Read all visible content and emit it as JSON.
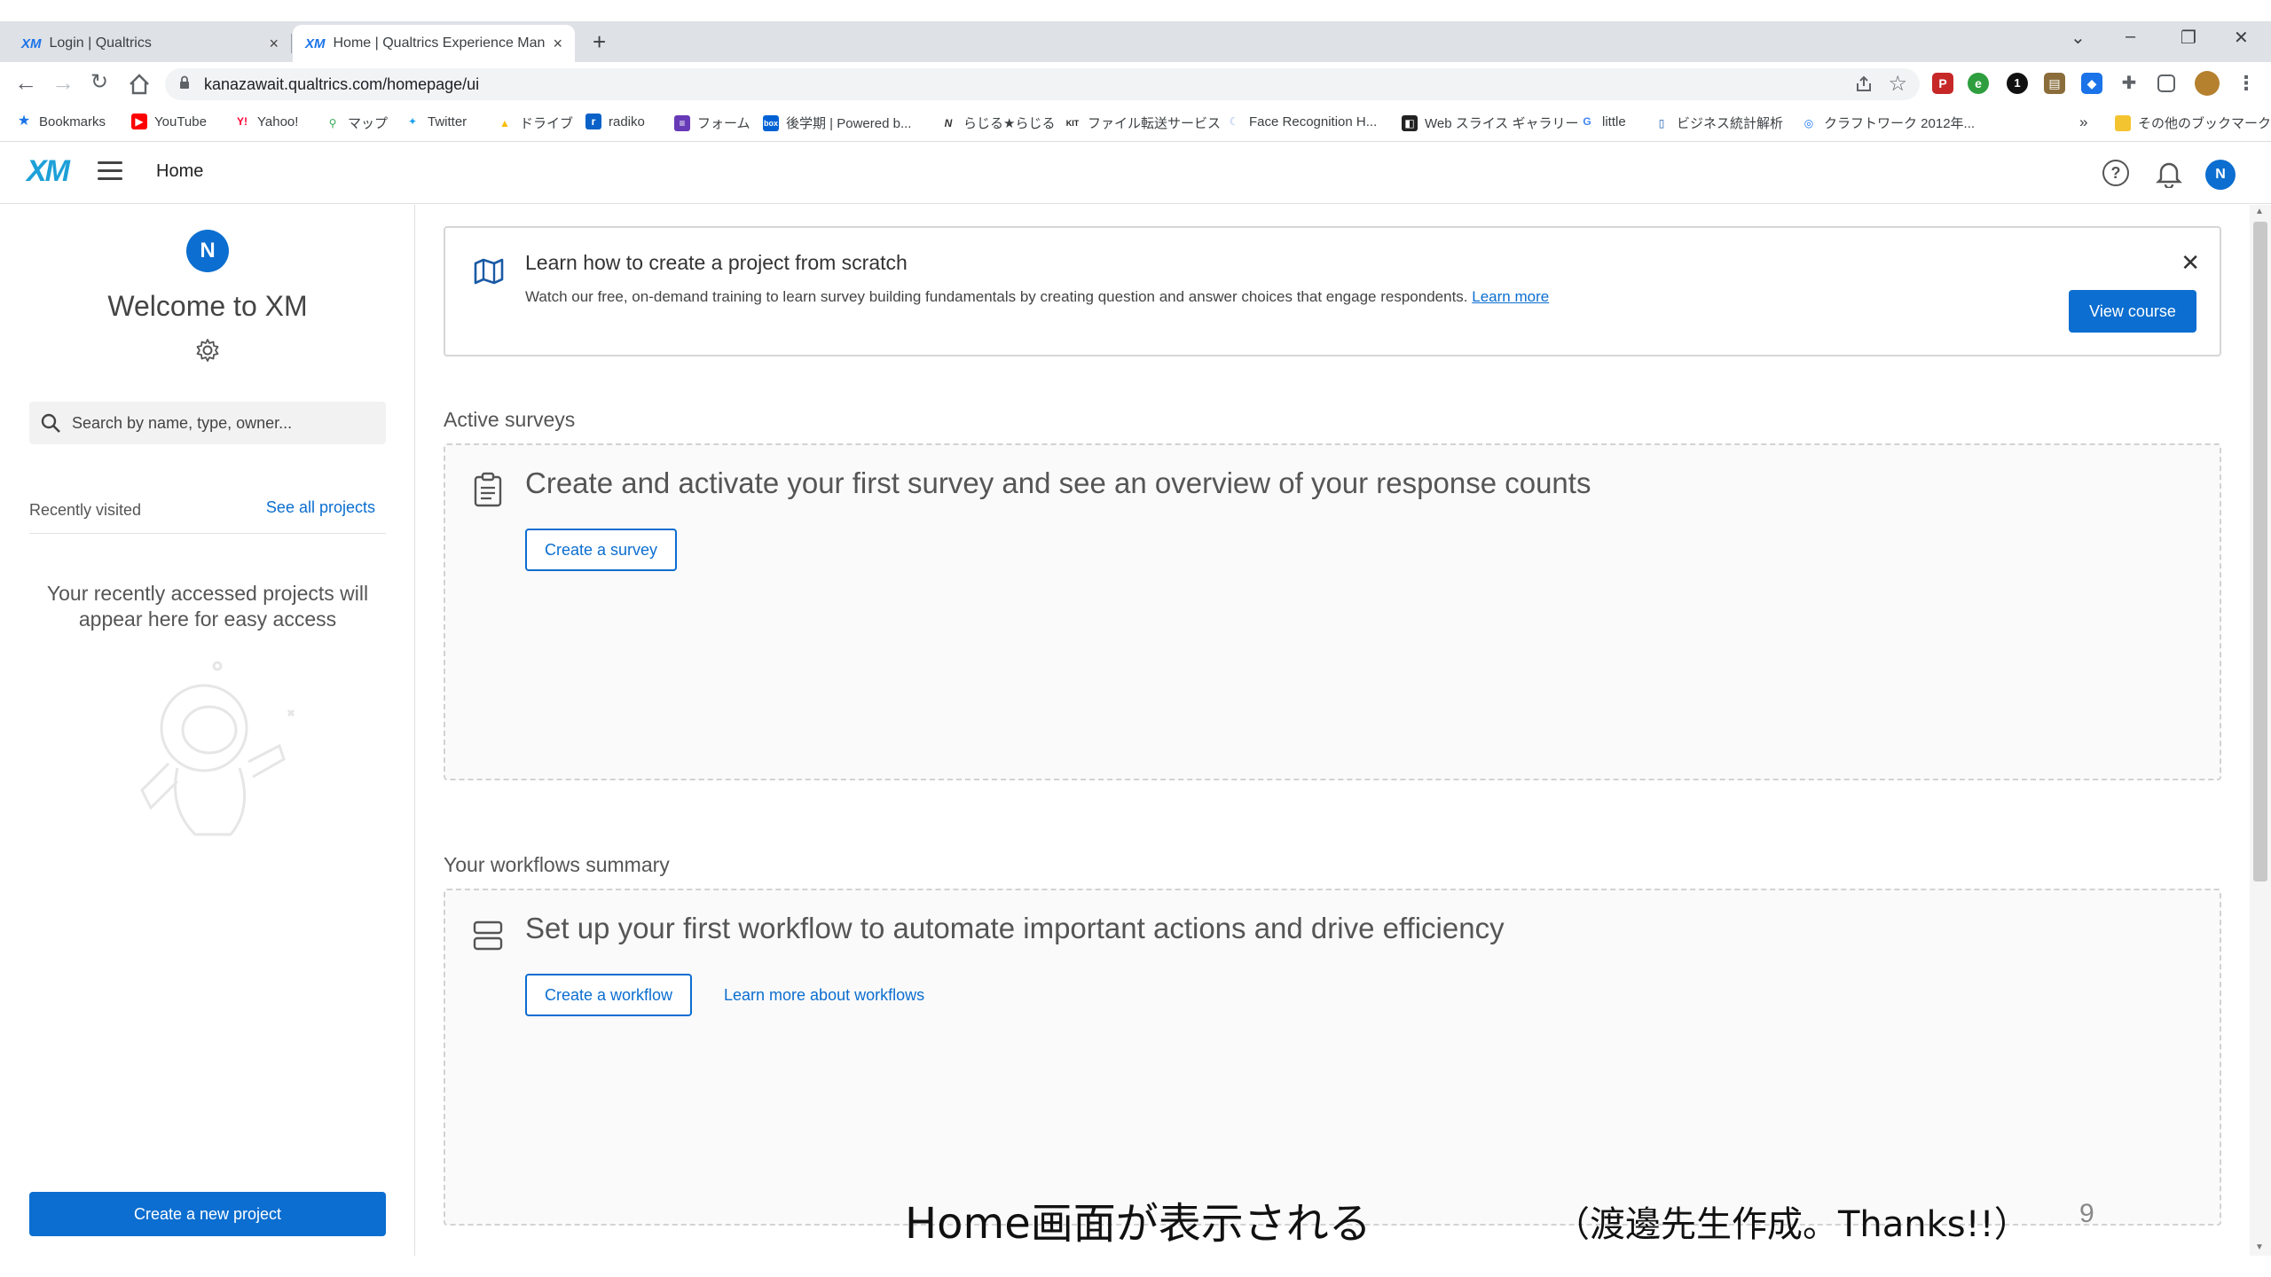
{
  "browser": {
    "tabs": [
      {
        "favicon": "XM",
        "title": "Login | Qualtrics",
        "close": "×"
      },
      {
        "favicon": "XM",
        "title": "Home | Qualtrics Experience Man",
        "close": "×"
      }
    ],
    "new_tab": "+",
    "window_controls": [
      "⌄",
      "–",
      "❐",
      "✕"
    ],
    "url": "kanazawait.qualtrics.com/homepage/ui",
    "bookmarks": [
      {
        "label": "Bookmarks",
        "icon": "star-icon",
        "color": "#1a73e8"
      },
      {
        "label": "YouTube",
        "icon": "youtube-icon",
        "color": "#ff0000"
      },
      {
        "label": "Yahoo!",
        "icon": "yahoo-icon",
        "color": "#ff0033"
      },
      {
        "label": "マップ",
        "icon": "maps-icon",
        "color": "#34a853"
      },
      {
        "label": "Twitter",
        "icon": "twitter-icon",
        "color": "#1da1f2"
      },
      {
        "label": "ドライブ",
        "icon": "drive-icon",
        "color": "#fbbc04"
      },
      {
        "label": "radiko",
        "icon": "radiko-icon",
        "color": "#0a62c8"
      },
      {
        "label": "フォーム",
        "icon": "forms-icon",
        "color": "#673ab7"
      },
      {
        "label": "後学期 | Powered b...",
        "icon": "box-icon",
        "color": "#0061d5"
      },
      {
        "label": "らじる★らじる",
        "icon": "nhk-icon",
        "color": "#333333"
      },
      {
        "label": "ファイル転送サービス",
        "icon": "kit-icon",
        "color": "#222222"
      },
      {
        "label": "Face Recognition H...",
        "icon": "face-icon",
        "color": "#9ab3e8"
      },
      {
        "label": "Web スライス ギャラリー",
        "icon": "slice-icon",
        "color": "#222222"
      },
      {
        "label": "little",
        "icon": "google-icon",
        "color": "#4285f4"
      },
      {
        "label": "ビジネス統計解析",
        "icon": "stats-icon",
        "color": "#1a5fb4"
      },
      {
        "label": "クラフトワーク 2012年...",
        "icon": "craft-icon",
        "color": "#1a73e8"
      }
    ],
    "bookmarks_overflow": "»",
    "other_bookmarks": "その他のブックマーク"
  },
  "app": {
    "logo": "XM",
    "title": "Home",
    "help": "?",
    "avatar_initial": "N"
  },
  "sidebar": {
    "avatar_initial": "N",
    "welcome": "Welcome to XM",
    "search_placeholder": "Search by name, type, owner...",
    "recent_label": "Recently visited",
    "see_all": "See all projects",
    "recent_empty": "Your recently accessed projects will appear here for easy access",
    "create_project": "Create a new project"
  },
  "banner": {
    "title": "Learn how to create a project from scratch",
    "description": "Watch our free, on-demand training to learn survey building fundamentals by creating question and answer choices that engage respondents.",
    "learn_more": "Learn more",
    "button": "View course",
    "close": "✕"
  },
  "active_surveys": {
    "heading": "Active surveys",
    "message": "Create and activate your first survey and see an overview of your response counts",
    "button": "Create a survey"
  },
  "workflows": {
    "heading": "Your workflows summary",
    "message": "Set up your first workflow to automate important actions and drive efficiency",
    "button": "Create a workflow",
    "link": "Learn more about workflows"
  },
  "slide": {
    "caption": "Home画面が表示される",
    "credit": "（渡邊先生作成。Thanks!!）",
    "page_number": "9"
  },
  "colors": {
    "accent": "#0b6ed0",
    "logo": "#1ea0d8"
  }
}
